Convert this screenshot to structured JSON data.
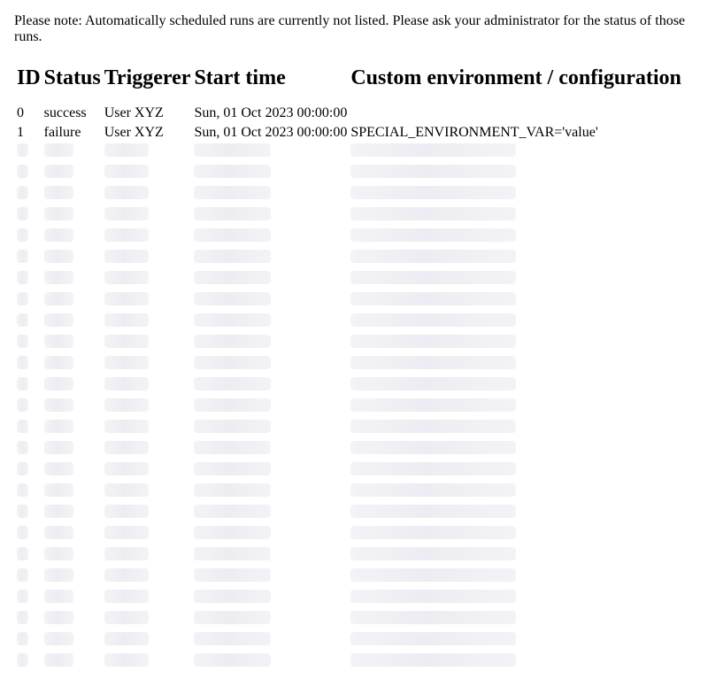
{
  "note": "Please note: Automatically scheduled runs are currently not listed. Please ask your administrator for the status of those runs.",
  "table": {
    "headers": {
      "id": "ID",
      "status": "Status",
      "triggerer": "Triggerer",
      "start_time": "Start time",
      "custom_env": "Custom environment / configuration"
    },
    "rows": [
      {
        "id": "0",
        "status": "success",
        "triggerer": "User XYZ",
        "start_time": "Sun, 01 Oct 2023 00:00:00",
        "custom_env": ""
      },
      {
        "id": "1",
        "status": "failure",
        "triggerer": "User XYZ",
        "start_time": "Sun, 01 Oct 2023 00:00:00",
        "custom_env": "SPECIAL_ENVIRONMENT_VAR='value'"
      }
    ],
    "loading_placeholder_rows": 25
  }
}
